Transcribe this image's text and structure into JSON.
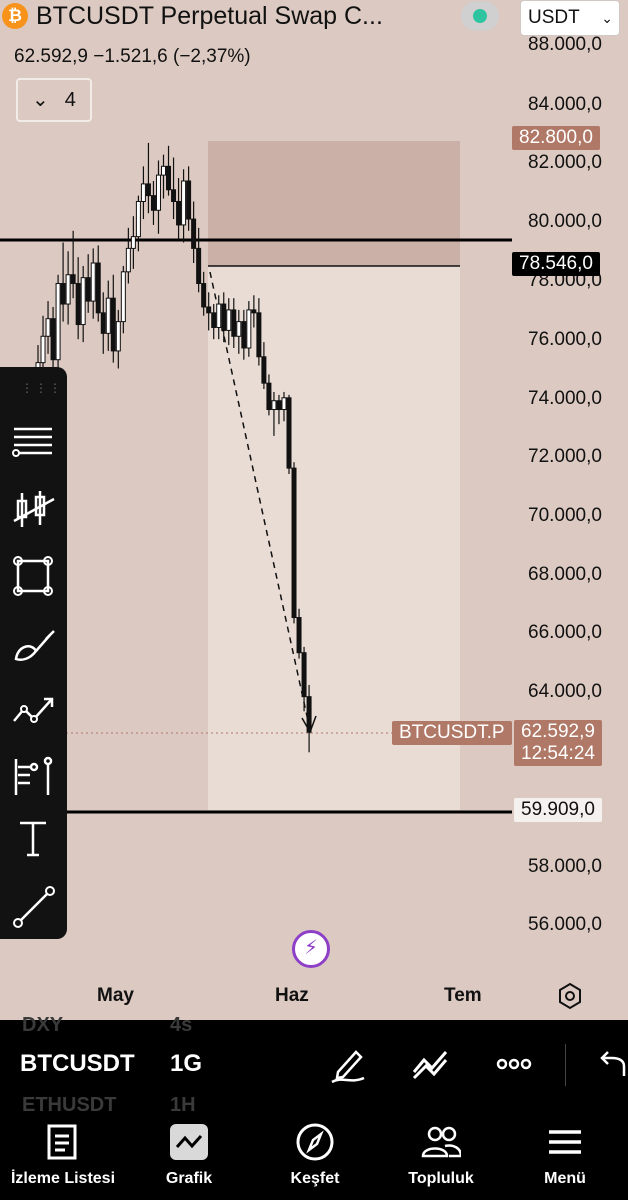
{
  "header": {
    "coin_glyph": "₿",
    "title": "BTCUSDT Perpetual Swap C...",
    "currency": "USDT",
    "ohlc_text": "62.592,9  −1.521,6 (−2,37%)",
    "indicator_count": "4"
  },
  "price_axis": {
    "labels": [
      "88.000,0",
      "84.000,0",
      "82.000,0",
      "80.000,0",
      "78.000,0",
      "76.000,0",
      "74.000,0",
      "72.000,0",
      "70.000,0",
      "68.000,0",
      "66.000,0",
      "64.000,0",
      "58.000,0",
      "56.000,0"
    ],
    "tag_top_short": "82.800,0",
    "tag_horizontal_line": "78.546,0",
    "tag_symbol": "BTCUSDT.P",
    "tag_last_price": "62.592,9",
    "tag_countdown": "12:54:24",
    "tag_support": "59.909,0"
  },
  "time_axis": {
    "may": "May",
    "jun": "Haz",
    "jul": "Tem"
  },
  "colors": {
    "accent_brown": "#b07866",
    "up": "#ffffff",
    "down": "#111111",
    "background": "#dccac2",
    "live": "#2ec4a0",
    "alert": "#8d3fc8"
  },
  "drawing_tools": [
    "lines-icon",
    "candles-icon",
    "rectangle-icon",
    "brush-icon",
    "pattern-icon",
    "fib-icon",
    "text-icon",
    "trendline-icon"
  ],
  "symbol_bar": {
    "ghost_above": "DXY",
    "ghost_above_tf": "4s",
    "symbol": "BTCUSDT",
    "timeframe": "1G",
    "ghost_below": "ETHUSDT",
    "ghost_below_tf": "1H"
  },
  "bottom_nav": [
    {
      "label": "İzleme Listesi",
      "icon": "watchlist-icon"
    },
    {
      "label": "Grafik",
      "icon": "chart-icon"
    },
    {
      "label": "Keşfet",
      "icon": "compass-icon"
    },
    {
      "label": "Topluluk",
      "icon": "community-icon"
    },
    {
      "label": "Menü",
      "icon": "menu-icon"
    }
  ],
  "chart_data": {
    "type": "candlestick",
    "price_axis_range": [
      55000,
      88500
    ],
    "short_position": {
      "entry": 78546,
      "stop": 82800,
      "target": 59909
    },
    "horizontal_lines": [
      79400,
      59909
    ],
    "last_price": 62592.9,
    "candles": [
      [
        74500,
        75800,
        73800,
        75200
      ],
      [
        75200,
        76800,
        74600,
        76100
      ],
      [
        76100,
        77300,
        75500,
        76700
      ],
      [
        76700,
        77100,
        74900,
        75300
      ],
      [
        75300,
        78200,
        75000,
        77900
      ],
      [
        77900,
        79300,
        76600,
        77200
      ],
      [
        77200,
        79000,
        76500,
        78200
      ],
      [
        78200,
        79700,
        77400,
        77900
      ],
      [
        77900,
        78800,
        76000,
        76500
      ],
      [
        76500,
        78500,
        75900,
        78100
      ],
      [
        78100,
        78900,
        76900,
        77300
      ],
      [
        77300,
        79100,
        76700,
        78600
      ],
      [
        78600,
        79200,
        76600,
        76900
      ],
      [
        76900,
        77600,
        75500,
        76200
      ],
      [
        76200,
        78000,
        75600,
        77400
      ],
      [
        77400,
        78200,
        75200,
        75600
      ],
      [
        75600,
        77000,
        75000,
        76600
      ],
      [
        76600,
        78500,
        76200,
        78300
      ],
      [
        78300,
        79800,
        77900,
        79100
      ],
      [
        79100,
        80200,
        78400,
        79500
      ],
      [
        79500,
        80900,
        79000,
        80700
      ],
      [
        80700,
        81900,
        80100,
        81300
      ],
      [
        81300,
        82700,
        80300,
        80900
      ],
      [
        80900,
        81400,
        79900,
        80400
      ],
      [
        80400,
        82100,
        79600,
        81600
      ],
      [
        81600,
        82300,
        80800,
        81900
      ],
      [
        81900,
        82600,
        80900,
        81100
      ],
      [
        81100,
        82200,
        80100,
        80700
      ],
      [
        80700,
        81500,
        79400,
        79900
      ],
      [
        79900,
        81800,
        79300,
        81400
      ],
      [
        81400,
        81900,
        79700,
        80100
      ],
      [
        80100,
        80700,
        78600,
        79100
      ],
      [
        79100,
        79800,
        77600,
        77900
      ],
      [
        77900,
        78300,
        76800,
        77100
      ],
      [
        77100,
        77600,
        76300,
        76900
      ],
      [
        76900,
        77200,
        76000,
        76400
      ],
      [
        76400,
        77500,
        76000,
        77200
      ],
      [
        77200,
        77600,
        75900,
        76300
      ],
      [
        76300,
        77400,
        75800,
        77000
      ],
      [
        77000,
        77400,
        75700,
        76100
      ],
      [
        76100,
        77000,
        75500,
        76600
      ],
      [
        76600,
        77000,
        75300,
        75700
      ],
      [
        75700,
        77300,
        75400,
        77000
      ],
      [
        77000,
        77500,
        76400,
        76900
      ],
      [
        76900,
        77400,
        75100,
        75400
      ],
      [
        75400,
        75900,
        74300,
        74500
      ],
      [
        74500,
        74800,
        73400,
        73600
      ],
      [
        73600,
        74200,
        72700,
        73900
      ],
      [
        73900,
        74100,
        73100,
        73600
      ],
      [
        73600,
        74200,
        73200,
        74000
      ],
      [
        74000,
        74100,
        71400,
        71600
      ],
      [
        71600,
        71800,
        66300,
        66500
      ],
      [
        66500,
        66800,
        65100,
        65300
      ],
      [
        65300,
        65500,
        63300,
        63800
      ],
      [
        63800,
        64200,
        61900,
        62590
      ]
    ]
  }
}
